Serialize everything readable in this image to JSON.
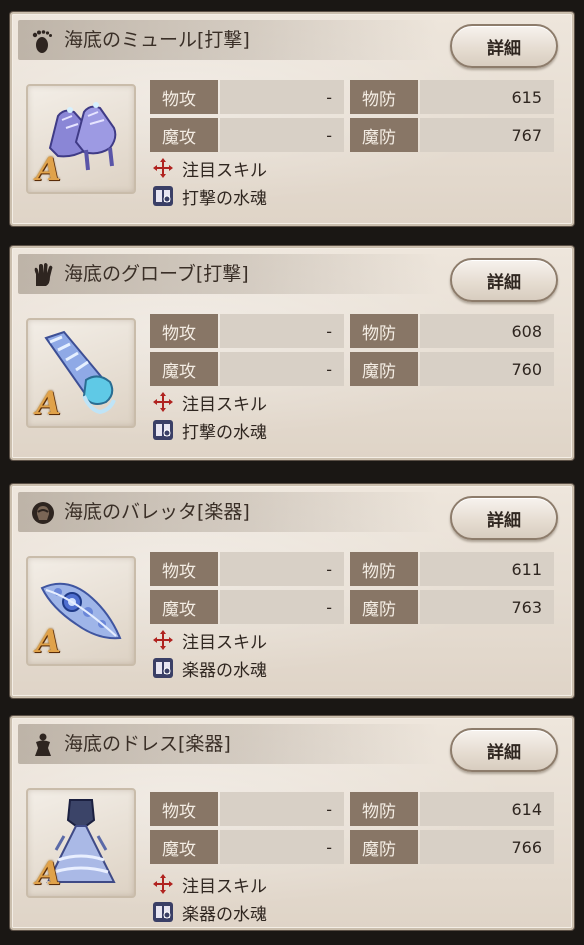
{
  "labels": {
    "detail_button": "詳細",
    "phys_attack": "物攻",
    "mag_attack": "魔攻",
    "phys_defense": "物防",
    "mag_defense": "魔防",
    "skill_focus": "注目スキル"
  },
  "items": [
    {
      "title": "海底のミュール[打撃]",
      "slot_icon": "foot-icon",
      "rank": "A",
      "phys_attack": "-",
      "mag_attack": "-",
      "phys_defense": "615",
      "mag_defense": "767",
      "soul": "打撃の水魂"
    },
    {
      "title": "海底のグローブ[打撃]",
      "slot_icon": "hand-icon",
      "rank": "A",
      "phys_attack": "-",
      "mag_attack": "-",
      "phys_defense": "608",
      "mag_defense": "760",
      "soul": "打撃の水魂"
    },
    {
      "title": "海底のバレッタ[楽器]",
      "slot_icon": "head-icon",
      "rank": "A",
      "phys_attack": "-",
      "mag_attack": "-",
      "phys_defense": "611",
      "mag_defense": "763",
      "soul": "楽器の水魂"
    },
    {
      "title": "海底のドレス[楽器]",
      "slot_icon": "body-icon",
      "rank": "A",
      "phys_attack": "-",
      "mag_attack": "-",
      "phys_defense": "614",
      "mag_defense": "766",
      "soul": "楽器の水魂"
    }
  ]
}
